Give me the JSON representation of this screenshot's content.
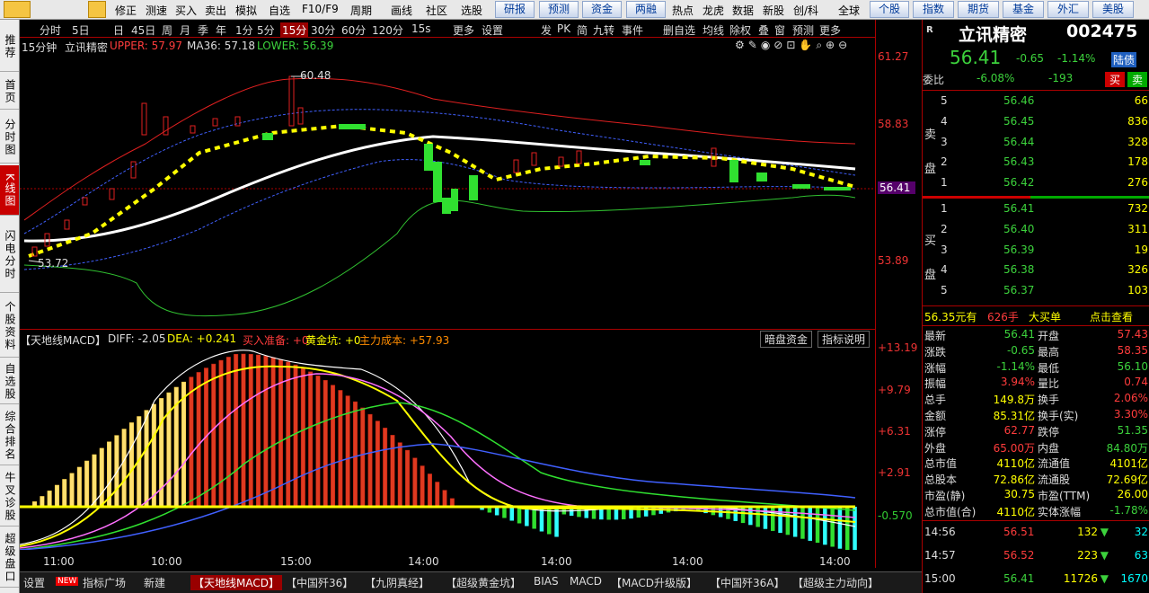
{
  "toolbar": {
    "items": [
      "修正",
      "测速",
      "买入",
      "卖出",
      "模拟",
      "自选",
      "F10/F9",
      "周期",
      "画线",
      "社区",
      "选股"
    ],
    "buttons": [
      "研报",
      "预测",
      "资金",
      "两融",
      "热点",
      "龙虎",
      "数据",
      "新股",
      "创/科",
      "全球",
      "个股",
      "指数",
      "期货",
      "基金",
      "外汇",
      "美股"
    ]
  },
  "leftnav": [
    "推荐",
    "首页",
    "分时图",
    "K线图",
    "闪电分时",
    "个股资料",
    "自选股",
    "综合排名",
    "牛叉诊股",
    "超级盘口"
  ],
  "periods": [
    "分时",
    "5日",
    "日",
    "45日",
    "周",
    "月",
    "季",
    "年",
    "1分",
    "5分",
    "15分",
    "30分",
    "60分",
    "120分",
    "15s",
    "更多",
    "设置"
  ],
  "tools": [
    "发",
    "PK",
    "简",
    "九转",
    "事件",
    "删自选",
    "均线",
    "除权",
    "叠",
    "窗",
    "预测",
    "更多"
  ],
  "info": {
    "period": "15分钟",
    "name": "立讯精密",
    "upper": "UPPER: 57.97",
    "ma": "MA36: 57.18",
    "lower": "LOWER: 56.39"
  },
  "yaxis": {
    "main": [
      "61.27",
      "58.83",
      "56.41",
      "53.89"
    ],
    "macd": [
      "+13.19",
      "+9.79",
      "+6.31",
      "+2.91",
      "-0.570"
    ]
  },
  "annotations": {
    "high": "60.48",
    "low": "53.72"
  },
  "macd": {
    "title": "【天地线MACD】",
    "diff": "DIFF: -2.05",
    "dea": "DEA: +0.241",
    "buyready": "买入准备: +0",
    "golden": "黄金坑: +0",
    "cost": "主力成本: +57.93",
    "btn1": "暗盘资金",
    "btn2": "指标说明"
  },
  "timeaxis": [
    "11:00",
    "10:00",
    "15:00",
    "14:00",
    "14:00",
    "14:00",
    "14:00"
  ],
  "bottomtabs": [
    "设置",
    "NEW",
    "指标广场",
    "新建",
    "【天地线MACD】",
    "【中国歼36】",
    "【九阴真经】",
    "【超级黄金坑】",
    "BIAS",
    "MACD",
    "【MACD升级版】",
    "【中国歼36A】",
    "【超级主力动向】"
  ],
  "quote": {
    "code_tag": "R",
    "name": "立讯精密",
    "code": "002475",
    "price": "56.41",
    "change": "-0.65",
    "pct": "-1.14%",
    "badge": "陆债",
    "weibi_label": "委比",
    "weibi": "-6.08%",
    "weicha": "-193",
    "sell_btn": "买",
    "buy_btn": "卖"
  },
  "sell": [
    {
      "n": "5",
      "p": "56.46",
      "v": "66"
    },
    {
      "n": "4",
      "p": "56.45",
      "v": "836"
    },
    {
      "n": "3",
      "p": "56.44",
      "v": "328"
    },
    {
      "n": "2",
      "p": "56.43",
      "v": "178"
    },
    {
      "n": "1",
      "p": "56.42",
      "v": "276"
    }
  ],
  "buy": [
    {
      "n": "1",
      "p": "56.41",
      "v": "732"
    },
    {
      "n": "2",
      "p": "56.40",
      "v": "311"
    },
    {
      "n": "3",
      "p": "56.39",
      "v": "19"
    },
    {
      "n": "4",
      "p": "56.38",
      "v": "326"
    },
    {
      "n": "5",
      "p": "56.37",
      "v": "103"
    }
  ],
  "sell_label": "卖盘",
  "buy_label": "买盘",
  "bigorder": {
    "a": "56.35元有",
    "b": "626手",
    "c": "大买单",
    "d": "点击查看"
  },
  "stats": [
    [
      "最新",
      "56.41",
      "开盘",
      "57.43"
    ],
    [
      "涨跌",
      "-0.65",
      "最高",
      "58.35"
    ],
    [
      "涨幅",
      "-1.14%",
      "最低",
      "56.10"
    ],
    [
      "振幅",
      "3.94%",
      "量比",
      "0.74"
    ],
    [
      "总手",
      "149.8万",
      "换手",
      "2.06%"
    ],
    [
      "金额",
      "85.31亿",
      "换手(实)",
      "3.30%"
    ],
    [
      "涨停",
      "62.77",
      "跌停",
      "51.35"
    ],
    [
      "外盘",
      "65.00万",
      "内盘",
      "84.80万"
    ],
    [
      "总市值",
      "4110亿",
      "流通值",
      "4101亿"
    ],
    [
      "总股本",
      "72.86亿",
      "流通股",
      "72.69亿"
    ],
    [
      "市盈(静)",
      "30.75",
      "市盈(TTM)",
      "26.00"
    ],
    [
      "总市值(合)",
      "4110亿",
      "实体涨幅",
      "-1.78%"
    ]
  ],
  "ticks": [
    {
      "t": "14:56",
      "p": "56.51",
      "v": "132",
      "n": "32"
    },
    {
      "t": "14:57",
      "p": "56.52",
      "v": "223",
      "n": "63"
    },
    {
      "t": "15:00",
      "p": "56.41",
      "v": "11726",
      "n": "1670"
    }
  ]
}
